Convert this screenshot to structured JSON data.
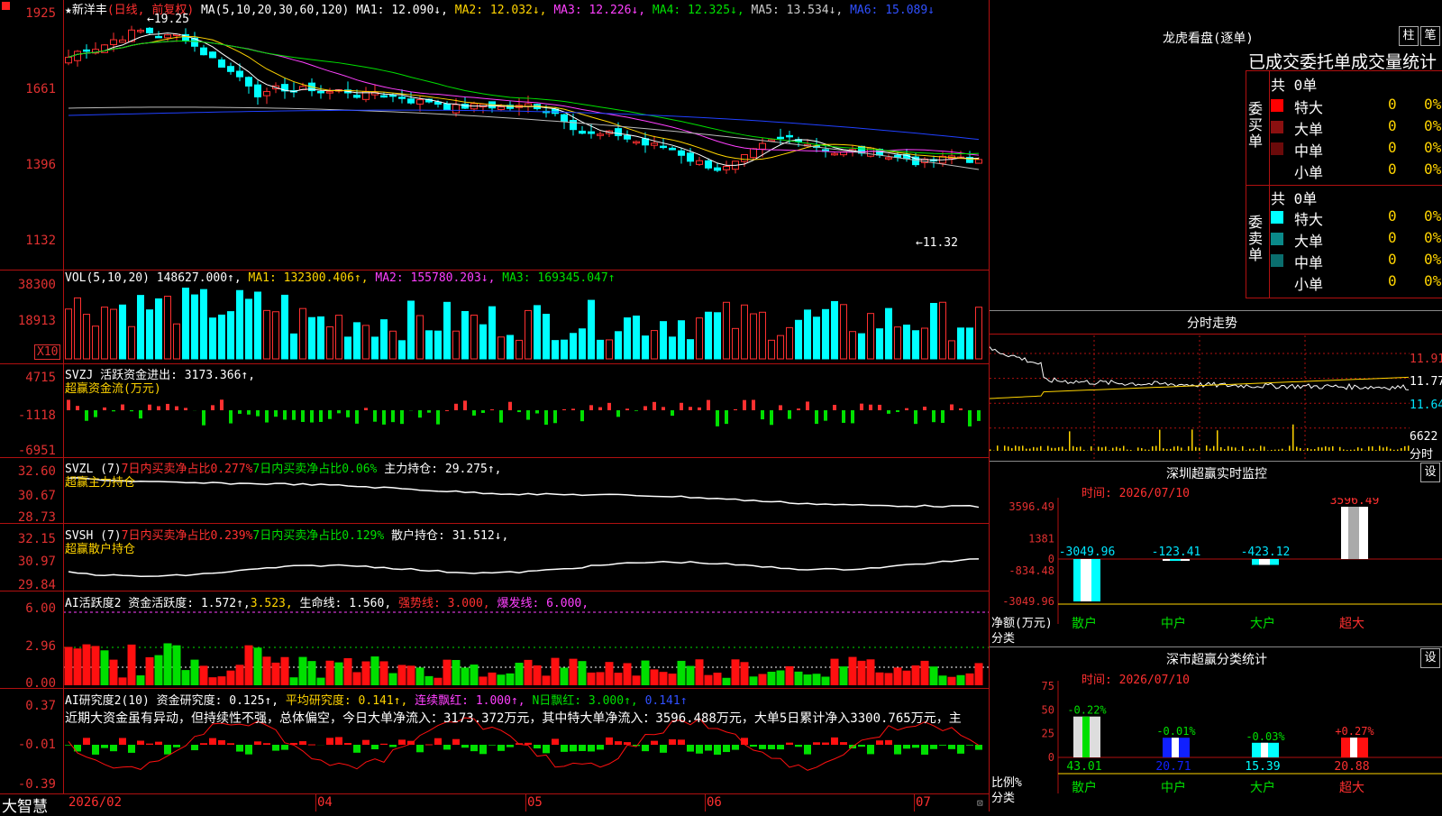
{
  "stock": {
    "name": "新洋丰",
    "period": "(日线, 前复权)"
  },
  "ma_line": {
    "prefix": "MA(5,10,20,30,60,120)",
    "ma1": "MA1: 12.090↓,",
    "ma2": "MA2: 12.032↓,",
    "ma3": "MA3: 12.226↓,",
    "ma4": "MA4: 12.325↓,",
    "ma5": "MA5: 13.534↓,",
    "ma6": "MA6: 15.089↓"
  },
  "price_axis": [
    "1925",
    "1661",
    "1396",
    "1132"
  ],
  "price_marks": {
    "high": "19.25",
    "low": "←11.32"
  },
  "vol": {
    "header": "VOL(5,10,20)",
    "value": "148627.000↑,",
    "ma1": "MA1: 132300.406↑,",
    "ma2": "MA2: 155780.203↓,",
    "ma3": "MA3: 169345.047↑",
    "axis": [
      "38300",
      "18913"
    ],
    "unit": "X10"
  },
  "svzj": {
    "header": "SVZJ  活跃资金进出: 3173.366↑,",
    "sub": "超赢资金流(万元)",
    "axis": [
      "4715",
      "-1118",
      "-6951"
    ]
  },
  "svzl": {
    "header_a": "SVZL (7)",
    "header_b": "7日内买卖净占比0.277%",
    "header_c": "7日内买卖净占比0.06%",
    "header_d": "主力持仓: 29.275↑,",
    "sub": "超赢主力持仓",
    "axis": [
      "32.60",
      "30.67",
      "28.73"
    ]
  },
  "svsh": {
    "header_a": "SVSH (7)",
    "header_b": "7日内买卖净占比0.239%",
    "header_c": "7日内买卖净占比0.129%",
    "header_d": "散户持仓: 31.512↓,",
    "sub": "超赢散户持仓",
    "axis": [
      "32.15",
      "30.97",
      "29.84"
    ]
  },
  "ai_active": {
    "header_a": "AI活跃度2 资金活跃度: 1.572↑,",
    "header_b": "3.523,",
    "header_c": "生命线: 1.560,",
    "header_d": "强势线: 3.000,",
    "header_e": "爆发线: 6.000,",
    "axis": [
      "6.00",
      "2.96",
      "0.00"
    ]
  },
  "ai_research": {
    "header_a": "AI研究度2(10) 资金研究度: 0.125↑,",
    "header_b": "平均研究度: 0.141↑,",
    "header_c": "连续飘红: 1.000↑,",
    "header_d": "N日飘红: 3.000↑,",
    "header_e": "0.141↑",
    "comment": "近期大资金虽有异动，但持续性不强，总体偏空，今日大单净流入：3173.372万元，其中特大单净流入：3596.488万元，大单5日累计净入3300.765万元，主",
    "axis": [
      "0.37",
      "-0.01",
      "-0.39"
    ]
  },
  "date_axis": [
    "2026/02",
    "04",
    "05",
    "06",
    "07"
  ],
  "brand": "大智慧",
  "right": {
    "lhb_title": "龙虎看盘(逐单)",
    "btn_bar": "柱",
    "btn_pen": "笔",
    "order_title": "已成交委托单成交量统计",
    "buy_group": "委买单",
    "sell_group": "委卖单",
    "buy_total": "共 0单",
    "sell_total": "共 0单",
    "rows": [
      "特大",
      "大单",
      "中单",
      "小单"
    ],
    "count": "0",
    "pct": "0%",
    "intraday_title": "分时走势",
    "intraday_axis": [
      "11.91",
      "11.77",
      "11.64"
    ],
    "intraday_vol": "6622",
    "intraday_vol_unit": "分时",
    "sz_title": "深圳超赢实时监控",
    "sz_btn": "设",
    "sz_date": "时间: 2026/07/10",
    "sz_axis": [
      "3596.49",
      "1381",
      "0",
      "-834.48",
      "-3049.96"
    ],
    "sz_unit_a": "净额(万元)",
    "sz_unit_b": "分类",
    "sz_cats": [
      "散户",
      "中户",
      "大户",
      "超大"
    ],
    "sz_vals": [
      "-3049.96",
      "-123.41",
      "-423.12",
      "3596.49"
    ],
    "sc_title": "深市超赢分类统计",
    "sc_btn": "设",
    "sc_date": "时间: 2026/07/10",
    "sc_axis": [
      "75",
      "50",
      "25",
      "0"
    ],
    "sc_unit_a": "比例%",
    "sc_unit_b": "分类",
    "sc_cats": [
      "散户",
      "中户",
      "大户",
      "超大"
    ],
    "sc_vals": [
      "43.01",
      "20.71",
      "15.39",
      "20.88"
    ],
    "sc_changes": [
      "-0.22%",
      "-0.01%",
      "-0.03%",
      "+0.27%"
    ]
  },
  "chart_data": [
    {
      "type": "bar",
      "title": "深圳超赢实时监控",
      "ylabel": "净额(万元)",
      "categories": [
        "散户",
        "中户",
        "大户",
        "超大"
      ],
      "values": [
        -3049.96,
        -123.41,
        -423.12,
        3596.49
      ],
      "ylim": [
        -3049.96,
        3596.49
      ]
    },
    {
      "type": "bar",
      "title": "深市超赢分类统计",
      "ylabel": "比例%",
      "categories": [
        "散户",
        "中户",
        "大户",
        "超大"
      ],
      "values": [
        43.01,
        20.71,
        15.39,
        20.88
      ],
      "ylim": [
        0,
        75
      ]
    }
  ]
}
